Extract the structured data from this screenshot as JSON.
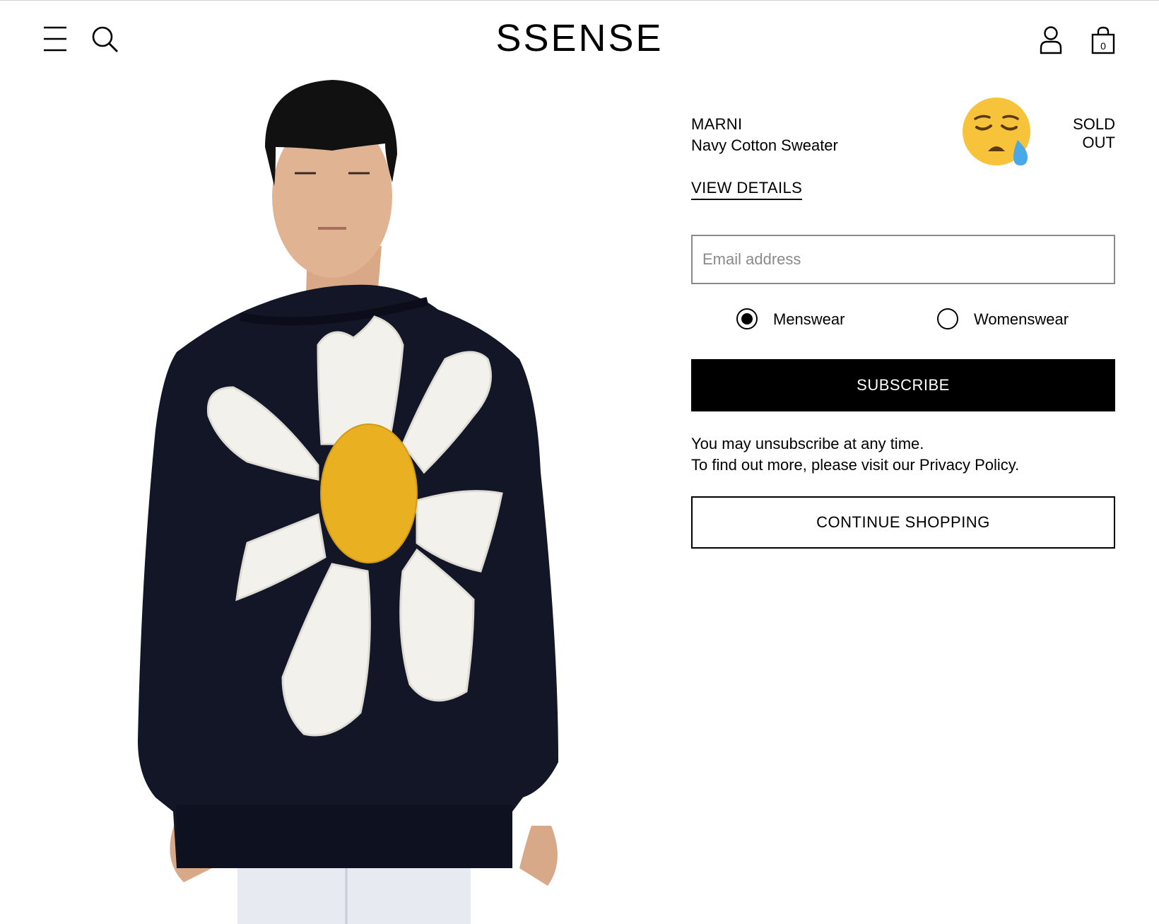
{
  "header": {
    "logo": "SSENSE",
    "bag_count": "0",
    "icons": [
      "hamburger-menu-icon",
      "search-icon",
      "account-icon",
      "shopping-bag-icon"
    ]
  },
  "product": {
    "brand": "MARNI",
    "name": "Navy Cotton Sweater",
    "status": "SOLD OUT",
    "status_icon": "sad-crying-face-emoji",
    "view_details_label": "VIEW DETAILS"
  },
  "subscribe_form": {
    "email_placeholder": "Email address",
    "email_value": "",
    "options": [
      {
        "label": "Menswear",
        "selected": true
      },
      {
        "label": "Womenswear",
        "selected": false
      }
    ],
    "subscribe_label": "SUBSCRIBE",
    "note_line1": "You may unsubscribe at any time.",
    "note_line2_prefix": "To find out more, please visit our ",
    "privacy_link": "Privacy Policy",
    "note_line2_suffix": "."
  },
  "continue_label": "CONTINUE SHOPPING",
  "colors": {
    "primary": "#000000",
    "background": "#ffffff",
    "input_border": "#8a8a8a",
    "sweater_navy": "#121626",
    "flower_white": "#f2f1ec",
    "flower_center": "#e9b122"
  }
}
